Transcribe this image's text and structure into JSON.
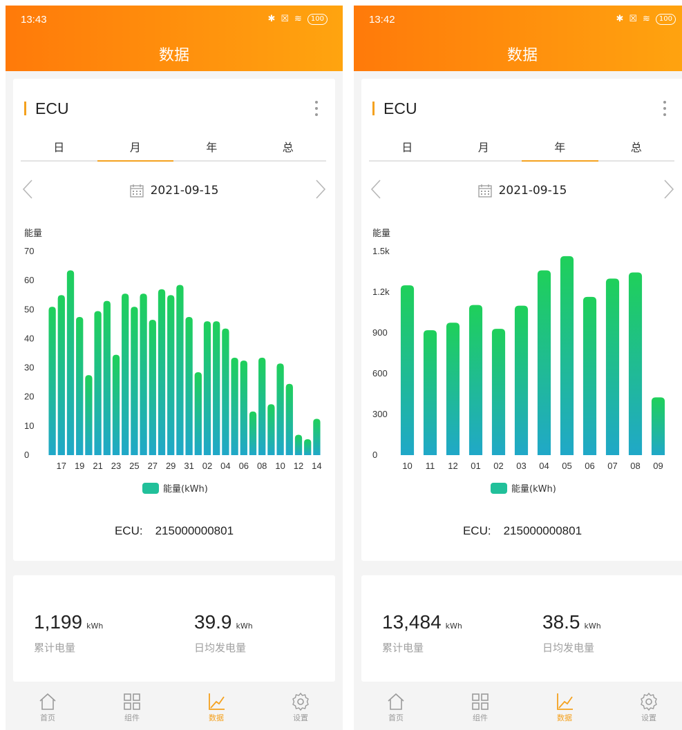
{
  "screens": [
    {
      "status_time": "13:43",
      "battery": "100",
      "title": "数据",
      "device_label": "ECU",
      "tabs": [
        "日",
        "月",
        "年",
        "总"
      ],
      "active_tab": 1,
      "date": "2021-09-15",
      "prev_symbol": "<",
      "next_symbol": ">",
      "ecu_serial_label": "ECU:",
      "ecu_serial": "215000000801",
      "chart_data": {
        "type": "bar",
        "title": "",
        "ylabel": "能量",
        "xlabel": "",
        "legend": "能量(kWh)",
        "legend_position": "bottom",
        "color_top": "#1fd05a",
        "color_bottom": "#20a8c8",
        "ylim": [
          0,
          70
        ],
        "yticks": [
          0,
          10,
          20,
          30,
          40,
          50,
          60,
          70
        ],
        "ytick_labels": [
          "0",
          "10",
          "20",
          "30",
          "40",
          "50",
          "60",
          "70"
        ],
        "xtick_labels": [
          "17",
          "19",
          "21",
          "23",
          "25",
          "27",
          "29",
          "31",
          "02",
          "04",
          "06",
          "08",
          "10",
          "12",
          "14"
        ],
        "categories": [
          "16",
          "17",
          "18",
          "19",
          "20",
          "21",
          "22",
          "23",
          "24",
          "25",
          "26",
          "27",
          "28",
          "29",
          "30",
          "31",
          "01",
          "02",
          "03",
          "04",
          "05",
          "06",
          "07",
          "08",
          "09",
          "10",
          "11",
          "12",
          "13",
          "14"
        ],
        "values": [
          51,
          55,
          63.5,
          47.5,
          27.5,
          49.5,
          53,
          34.5,
          55.5,
          51,
          55.5,
          46.5,
          57,
          55,
          58.5,
          47.5,
          28.5,
          46,
          46,
          43.5,
          33.5,
          32.5,
          15,
          33.5,
          17.5,
          31.5,
          24.5,
          7,
          5.5,
          12.5
        ],
        "grid": false
      },
      "stats": {
        "total_value": "1,199",
        "total_unit": "kWh",
        "total_label": "累计电量",
        "avg_value": "39.9",
        "avg_unit": "kWh",
        "avg_label": "日均发电量"
      },
      "nav": [
        {
          "label": "首页",
          "icon": "home-icon"
        },
        {
          "label": "组件",
          "icon": "grid-icon"
        },
        {
          "label": "数据",
          "icon": "chart-icon"
        },
        {
          "label": "设置",
          "icon": "gear-icon"
        }
      ],
      "nav_active": 2,
      "accent_color": "#f4a11e"
    },
    {
      "status_time": "13:42",
      "battery": "100",
      "title": "数据",
      "device_label": "ECU",
      "tabs": [
        "日",
        "月",
        "年",
        "总"
      ],
      "active_tab": 2,
      "date": "2021-09-15",
      "prev_symbol": "<",
      "next_symbol": ">",
      "ecu_serial_label": "ECU:",
      "ecu_serial": "215000000801",
      "chart_data": {
        "type": "bar",
        "title": "",
        "ylabel": "能量",
        "xlabel": "",
        "legend": "能量(kWh)",
        "legend_position": "bottom",
        "color_top": "#1fd05a",
        "color_bottom": "#20a8c8",
        "ylim": [
          0,
          1500
        ],
        "yticks": [
          0,
          300,
          600,
          900,
          1200,
          1500
        ],
        "ytick_labels": [
          "0",
          "300",
          "600",
          "900",
          "1.2k",
          "1.5k"
        ],
        "xtick_labels": [
          "10",
          "11",
          "12",
          "01",
          "02",
          "03",
          "04",
          "05",
          "06",
          "07",
          "08",
          "09"
        ],
        "categories": [
          "10",
          "11",
          "12",
          "01",
          "02",
          "03",
          "04",
          "05",
          "06",
          "07",
          "08",
          "09"
        ],
        "values": [
          1250,
          920,
          975,
          1105,
          930,
          1100,
          1360,
          1465,
          1165,
          1300,
          1345,
          425
        ],
        "grid": false
      },
      "stats": {
        "total_value": "13,484",
        "total_unit": "kWh",
        "total_label": "累计电量",
        "avg_value": "38.5",
        "avg_unit": "kWh",
        "avg_label": "日均发电量"
      },
      "nav": [
        {
          "label": "首页",
          "icon": "home-icon"
        },
        {
          "label": "组件",
          "icon": "grid-icon"
        },
        {
          "label": "数据",
          "icon": "chart-icon"
        },
        {
          "label": "设置",
          "icon": "gear-icon"
        }
      ],
      "nav_active": 2,
      "accent_color": "#f4a11e"
    }
  ]
}
